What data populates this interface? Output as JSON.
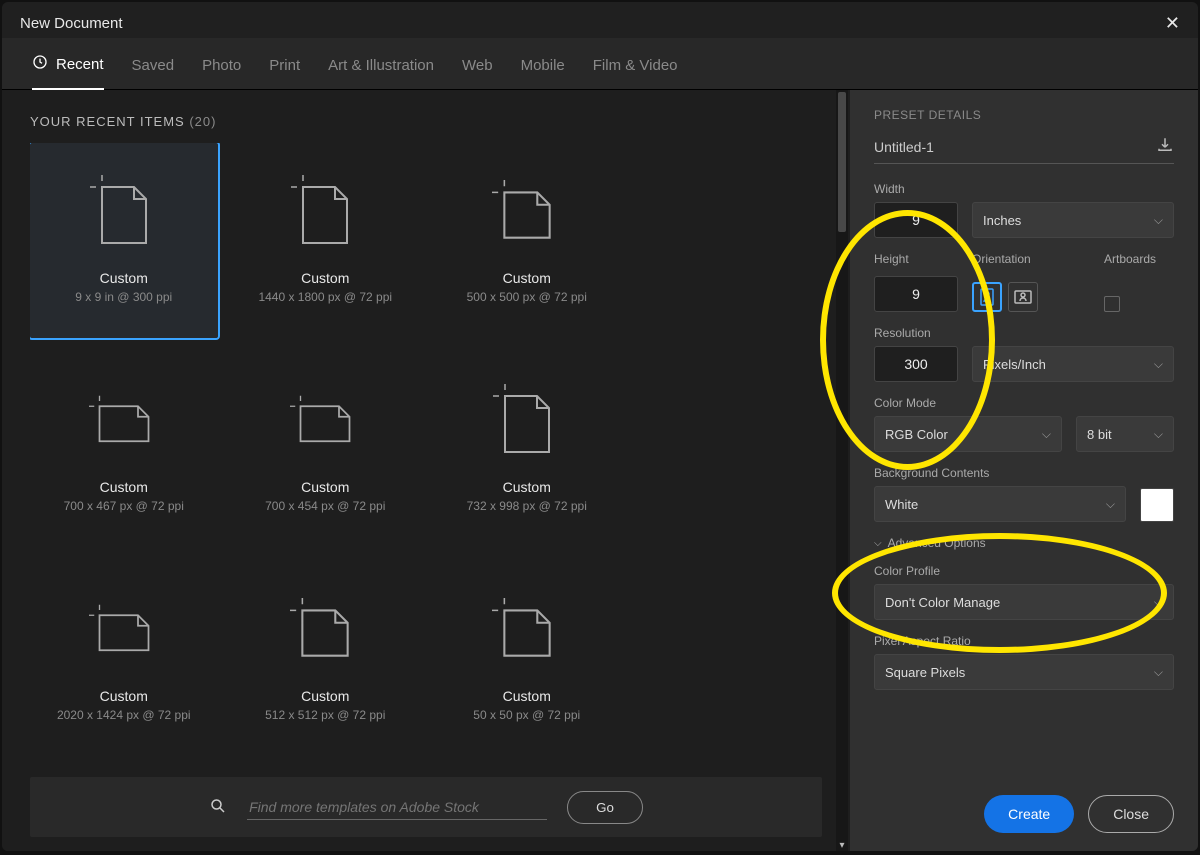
{
  "window_title": "New Document",
  "tabs": [
    "Recent",
    "Saved",
    "Photo",
    "Print",
    "Art & Illustration",
    "Web",
    "Mobile",
    "Film & Video"
  ],
  "recent_header": {
    "label": "YOUR RECENT ITEMS",
    "count": "(20)"
  },
  "presets": [
    {
      "label": "Custom",
      "size": "9 x 9 in @ 300 ppi",
      "shape": "portrait",
      "selected": true
    },
    {
      "label": "Custom",
      "size": "1440 x 1800 px @ 72 ppi",
      "shape": "portrait"
    },
    {
      "label": "Custom",
      "size": "500 x 500 px @ 72 ppi",
      "shape": "square"
    },
    {
      "label": "",
      "size": "",
      "shape": "none"
    },
    {
      "label": "Custom",
      "size": "700 x 467 px @ 72 ppi",
      "shape": "landscape"
    },
    {
      "label": "Custom",
      "size": "700 x 454 px @ 72 ppi",
      "shape": "landscape"
    },
    {
      "label": "Custom",
      "size": "732 x 998 px @ 72 ppi",
      "shape": "portrait"
    },
    {
      "label": "",
      "size": "",
      "shape": "none"
    },
    {
      "label": "Custom",
      "size": "2020 x 1424 px @ 72 ppi",
      "shape": "landscape"
    },
    {
      "label": "Custom",
      "size": "512 x 512 px @ 72 ppi",
      "shape": "square"
    },
    {
      "label": "Custom",
      "size": "50 x 50 px @ 72 ppi",
      "shape": "square"
    },
    {
      "label": "",
      "size": "",
      "shape": "none"
    }
  ],
  "search": {
    "placeholder": "Find more templates on Adobe Stock",
    "go": "Go"
  },
  "right": {
    "header": "PRESET DETAILS",
    "docname": "Untitled-1",
    "width": {
      "label": "Width",
      "value": "9",
      "unit": "Inches"
    },
    "height": {
      "label": "Height",
      "value": "9"
    },
    "orientation_label": "Orientation",
    "artboards_label": "Artboards",
    "resolution": {
      "label": "Resolution",
      "value": "300",
      "unit": "Pixels/Inch"
    },
    "colormode": {
      "label": "Color Mode",
      "value": "RGB Color",
      "depth": "8 bit"
    },
    "background": {
      "label": "Background Contents",
      "value": "White"
    },
    "advanced": "Advanced Options",
    "colorprofile": {
      "label": "Color Profile",
      "value": "Don't Color Manage"
    },
    "pixelratio": {
      "label": "Pixel Aspect Ratio",
      "value": "Square Pixels"
    }
  },
  "buttons": {
    "create": "Create",
    "close": "Close"
  }
}
